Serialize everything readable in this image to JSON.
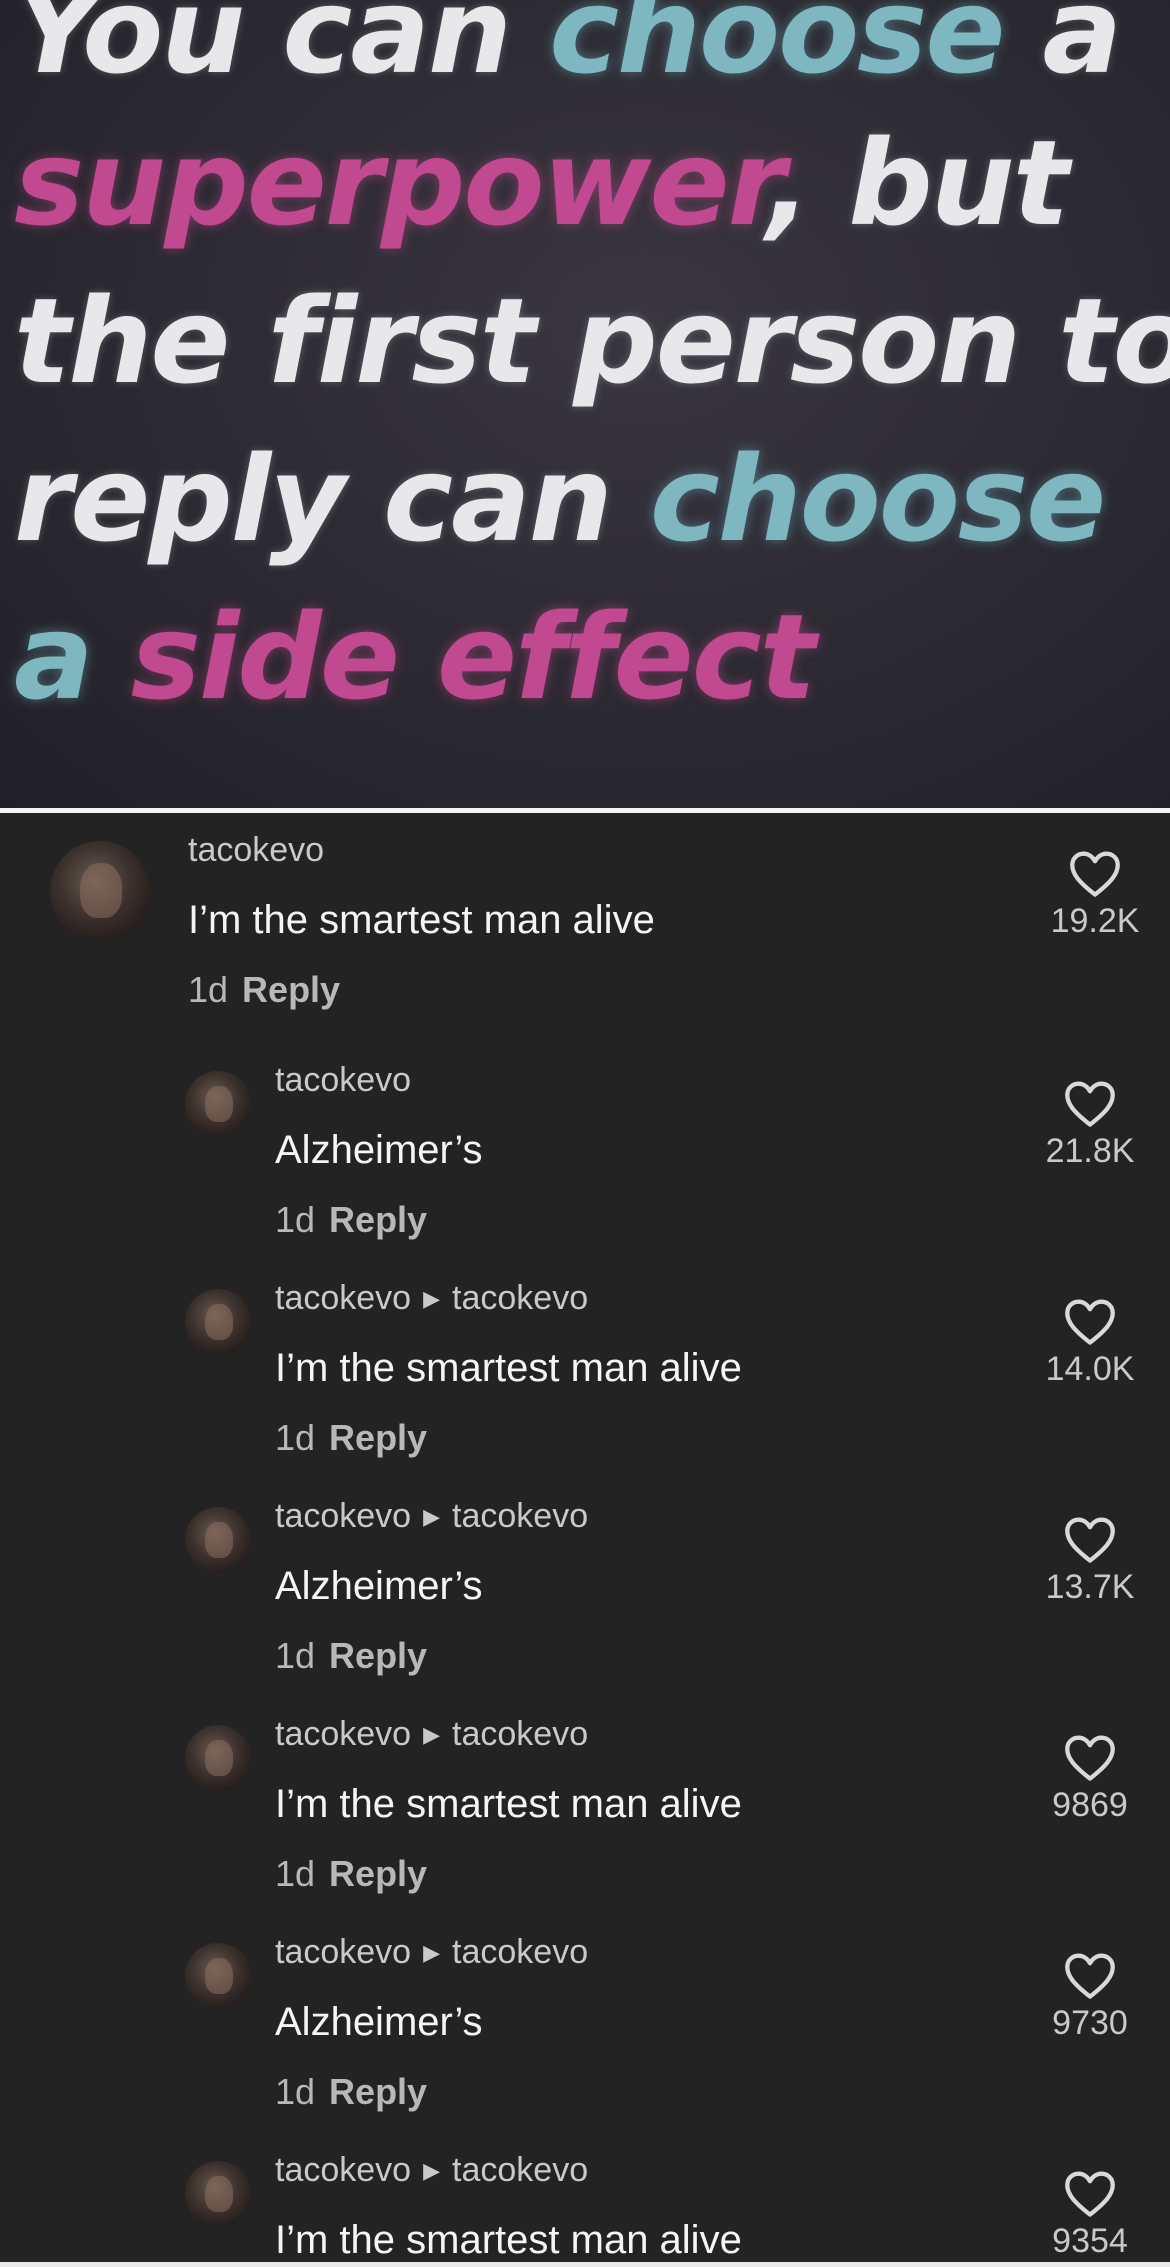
{
  "banner": {
    "line1": [
      {
        "t": "You can ",
        "c": "white"
      },
      {
        "t": "choose",
        "c": "cyan"
      },
      {
        "t": " a",
        "c": "white"
      }
    ],
    "line2": [
      {
        "t": "superpower",
        "c": "pink"
      },
      {
        "t": ", but",
        "c": "white"
      }
    ],
    "line3": [
      {
        "t": "the first person to",
        "c": "white"
      }
    ],
    "line4": [
      {
        "t": "reply can ",
        "c": "white"
      },
      {
        "t": "choose",
        "c": "cyan"
      }
    ],
    "line5": [
      {
        "t": "a ",
        "c": "cyan"
      },
      {
        "t": "side effect",
        "c": "pink"
      }
    ]
  },
  "colors": {
    "background": "#232324",
    "cyan_text": "#7fb7c1",
    "pink_text": "#c0498f"
  },
  "icons": {
    "like": "heart-outline-icon",
    "reply_arrow": "triangle-right-icon"
  },
  "comments": [
    {
      "user": "tacokevo",
      "reply_to": "",
      "text": "I’m the smartest man alive",
      "age": "1d",
      "reply_label": "Reply",
      "likes": "19.2K"
    },
    {
      "user": "tacokevo",
      "reply_to": "",
      "text": "Alzheimer’s",
      "age": "1d",
      "reply_label": "Reply",
      "likes": "21.8K"
    },
    {
      "user": "tacokevo",
      "reply_to": "tacokevo",
      "text": "I’m the smartest man alive",
      "age": "1d",
      "reply_label": "Reply",
      "likes": "14.0K"
    },
    {
      "user": "tacokevo",
      "reply_to": "tacokevo",
      "text": "Alzheimer’s",
      "age": "1d",
      "reply_label": "Reply",
      "likes": "13.7K"
    },
    {
      "user": "tacokevo",
      "reply_to": "tacokevo",
      "text": "I’m the smartest man alive",
      "age": "1d",
      "reply_label": "Reply",
      "likes": "9869"
    },
    {
      "user": "tacokevo",
      "reply_to": "tacokevo",
      "text": "Alzheimer’s",
      "age": "1d",
      "reply_label": "Reply",
      "likes": "9730"
    },
    {
      "user": "tacokevo",
      "reply_to": "tacokevo",
      "text": "I’m the smartest man alive",
      "age": "",
      "reply_label": "",
      "likes": "9354"
    }
  ]
}
